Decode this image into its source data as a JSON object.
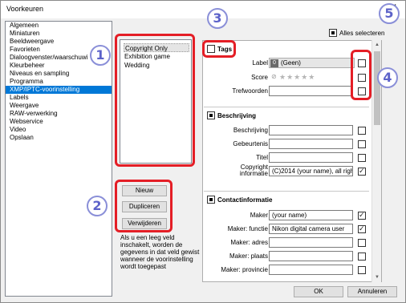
{
  "window": {
    "title": "Voorkeuren",
    "close_glyph": "✕"
  },
  "categories": {
    "items": [
      "Algemeen",
      "Miniaturen",
      "Beeldweergave",
      "Favorieten",
      "Dialoogvenster/waarschuwi",
      "Kleurbeheer",
      "Niveaus en sampling",
      "Programma",
      "XMP/IPTC-voorinstelling",
      "Labels",
      "Weergave",
      "RAW-verwerking",
      "Webservice",
      "Video",
      "Opslaan"
    ],
    "selected": "XMP/IPTC-voorinstelling"
  },
  "presets": {
    "items": [
      "Copyright Only",
      "Exhibition game",
      "Wedding"
    ],
    "selected": "Copyright Only",
    "new_label": "Nieuw",
    "duplicate_label": "Dupliceren",
    "delete_label": "Verwijderen",
    "help_text": "Als u een leeg veld inschakelt, worden de gegevens in dat veld gewist wanneer de voorinstelling wordt toegepast"
  },
  "select_all_label": "Alles selecteren",
  "tags": {
    "header": "Tags",
    "label_label": "Label",
    "label_number": "0",
    "label_value": "(Geen)",
    "score_label": "Score",
    "score_stars": "★★★★★",
    "score_clear": "⊘",
    "keywords_label": "Trefwoorden",
    "keywords_value": ""
  },
  "description_section": {
    "header": "Beschrijving",
    "fields": [
      {
        "label": "Beschrijving",
        "value": "",
        "checked": false
      },
      {
        "label": "Gebeurtenis",
        "value": "",
        "checked": false
      },
      {
        "label": "Titel",
        "value": "",
        "checked": false
      },
      {
        "label": "Copyright informatie",
        "label_line1": "Copyright",
        "label_line2": "informatie",
        "value": "(C)2014 (your name), all rights r",
        "checked": true
      }
    ]
  },
  "contact_section": {
    "header": "Contactinformatie",
    "fields": [
      {
        "label": "Maker",
        "value": "(your name)",
        "checked": true
      },
      {
        "label": "Maker: functie",
        "value": "Nikon digital camera user",
        "checked": true
      },
      {
        "label": "Maker: adres",
        "value": "",
        "checked": false
      },
      {
        "label": "Maker: plaats",
        "value": "",
        "checked": false
      },
      {
        "label": "Maker: provincie",
        "value": "",
        "checked": false
      }
    ]
  },
  "footer": {
    "ok_label": "OK",
    "cancel_label": "Annuleren"
  },
  "callouts": {
    "one": "1",
    "two": "2",
    "three": "3",
    "four": "4",
    "five": "5",
    "color": "#e41e26"
  }
}
